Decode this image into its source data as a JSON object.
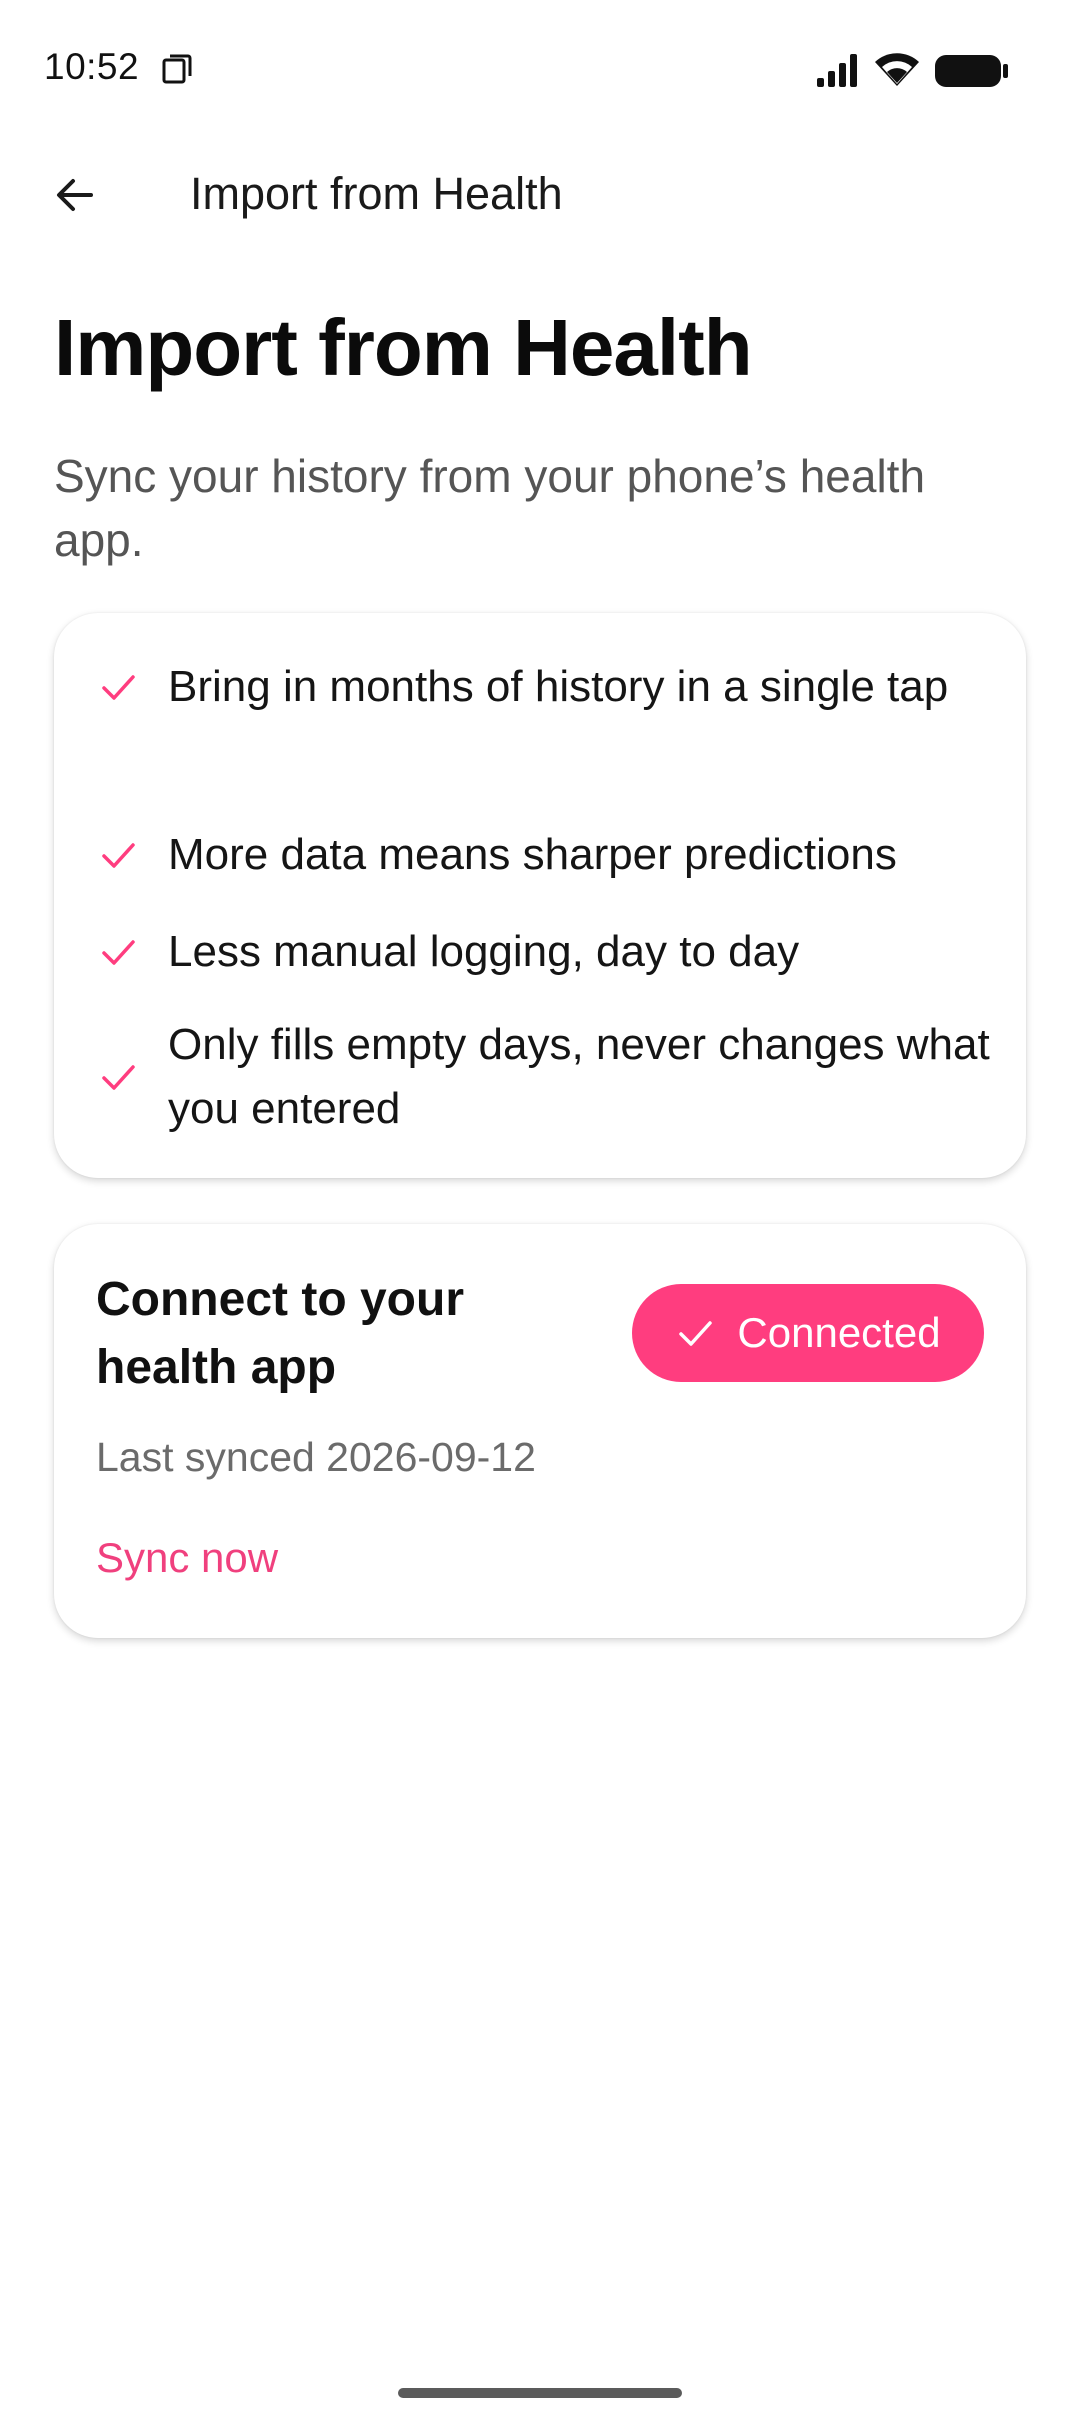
{
  "status_bar": {
    "time": "10:52",
    "icons": [
      "screen-record-icon",
      "signal-icon",
      "wifi-icon",
      "battery-icon"
    ]
  },
  "app_bar": {
    "title": "Import from Health",
    "back_icon": "arrow-left-icon"
  },
  "page": {
    "title": "Import from Health",
    "subtitle": "Sync your history from your phone’s health app."
  },
  "benefits": {
    "icon": "check-icon",
    "items": [
      {
        "label": "Bring in months of history in a single tap"
      },
      {
        "label": "More data means sharper predictions"
      },
      {
        "label": "Less manual logging, day to day"
      },
      {
        "label": "Only fills empty days, never changes what you entered"
      }
    ]
  },
  "connect": {
    "title": "Connect to your health app",
    "status_button_label": "Connected",
    "last_synced": "Last synced 2026-09-12",
    "sync_now_label": "Sync now"
  },
  "colors": {
    "accent": "#ff3d7f",
    "accent_text": "#f0407e",
    "text_primary": "#111111",
    "text_secondary": "#6b6b6b"
  }
}
